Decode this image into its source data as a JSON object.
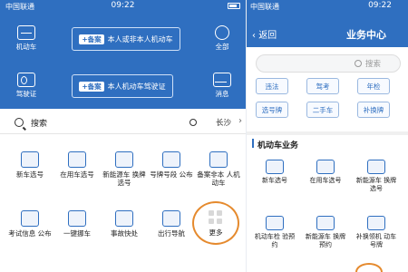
{
  "left": {
    "status": {
      "carrier": "中国联通",
      "time": "09:22"
    },
    "side_icons": [
      {
        "label": "机动车"
      },
      {
        "label": "全部"
      },
      {
        "label": "驾驶证"
      },
      {
        "label": "消息"
      }
    ],
    "banners": [
      {
        "tag": "+备案",
        "text": "本人或非本人机动车"
      },
      {
        "tag": "+备案",
        "text": "本人机动车驾驶证"
      }
    ],
    "search": {
      "label": "搜索",
      "location": "长沙"
    },
    "grid": [
      {
        "label": "新车选号"
      },
      {
        "label": "在用车选号"
      },
      {
        "label": "新能源车 换牌选号"
      },
      {
        "label": "号牌号段 公布"
      },
      {
        "label": "备案非本 人机动车"
      },
      {
        "label": "考试信息 公布"
      },
      {
        "label": "一键挪车"
      },
      {
        "label": "事故快处"
      },
      {
        "label": "出行导航"
      },
      {
        "label": "更多"
      }
    ]
  },
  "right": {
    "status": {
      "carrier": "中国联通",
      "time": "09:22"
    },
    "back_label": "返回",
    "title": "业务中心",
    "search_placeholder": "搜索",
    "chips": [
      "违法",
      "驾考",
      "年检",
      "选号牌",
      "二手车",
      "补换牌"
    ],
    "section_title": "机动车业务",
    "items": [
      {
        "label": "新车选号"
      },
      {
        "label": "在用车选号"
      },
      {
        "label": "新能源车 换牌选号"
      },
      {
        "label": "机动车检 验预约"
      },
      {
        "label": "新能源车 换牌预约"
      },
      {
        "label": "补换领机 动车号牌"
      }
    ]
  }
}
